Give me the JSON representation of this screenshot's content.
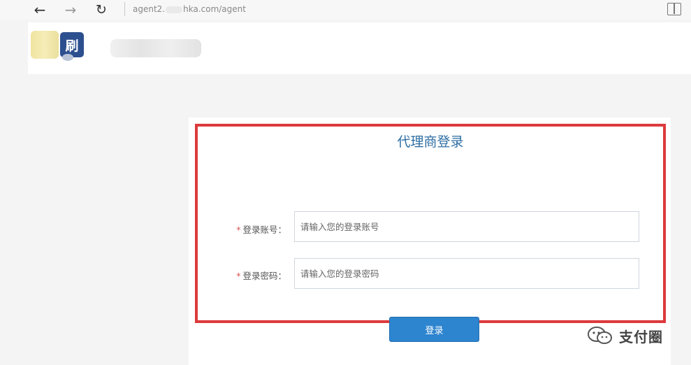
{
  "browser": {
    "url_prefix": "agent2.",
    "url_suffix": "hka.com/agent"
  },
  "header": {
    "logo_char": "刷"
  },
  "login": {
    "title": "代理商登录",
    "required_mark": "*",
    "account_label": "登录账号：",
    "account_placeholder": "请输入您的登录账号",
    "account_value": "",
    "password_label": "登录密码：",
    "password_placeholder": "请输入您的登录密码",
    "password_value": "",
    "submit_label": "登录"
  },
  "watermark": {
    "text": "支付圈"
  },
  "colors": {
    "highlight": "#dd3a3d",
    "title": "#2d6ea3",
    "button": "#2d84cf",
    "logo": "#2c4f8f"
  }
}
